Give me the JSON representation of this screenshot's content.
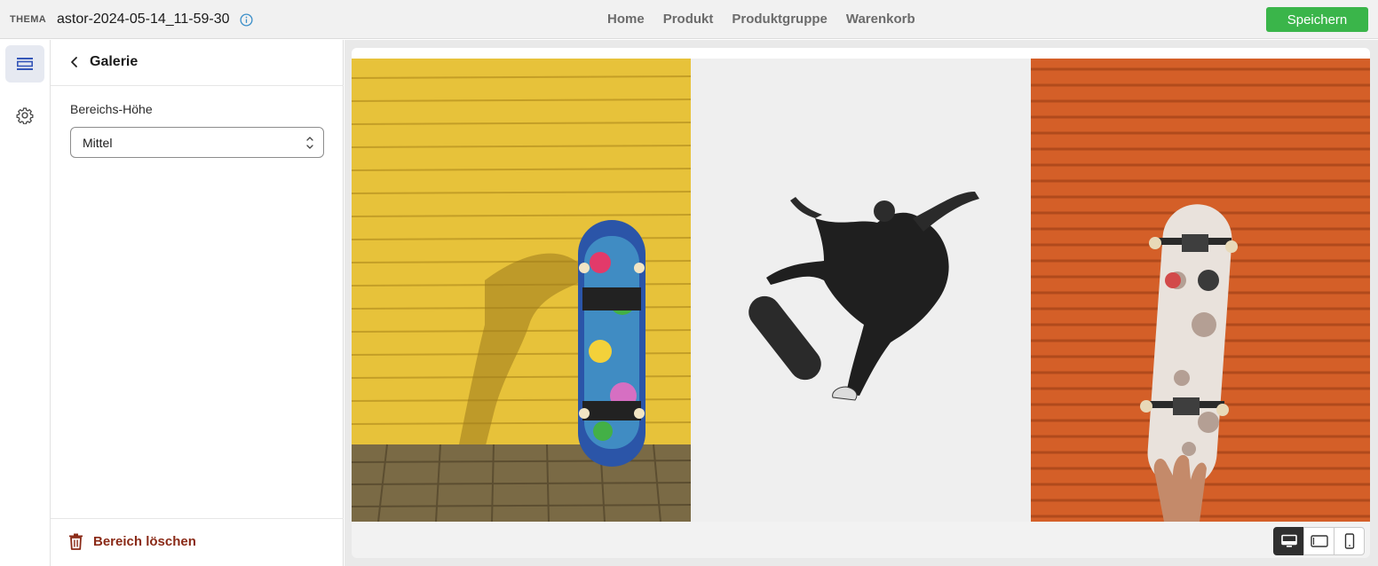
{
  "topbar": {
    "theme_tag": "THEMA",
    "theme_name": "astor-2024-05-14_11-59-30",
    "info_icon": "info-icon",
    "nav": [
      {
        "label": "Home"
      },
      {
        "label": "Produkt"
      },
      {
        "label": "Produktgruppe"
      },
      {
        "label": "Warenkorb"
      }
    ],
    "save_label": "Speichern",
    "save_color": "#3ab54a"
  },
  "rail": {
    "items": [
      {
        "icon": "sections-icon",
        "active": true
      },
      {
        "icon": "gear-icon",
        "active": false
      }
    ]
  },
  "panel": {
    "title": "Galerie",
    "back_icon": "chevron-left-icon",
    "field_label": "Bereichs-Höhe",
    "select_value": "Mittel",
    "delete_label": "Bereich löschen",
    "delete_color": "#8a2a17"
  },
  "preview": {
    "images": [
      {
        "subject": "skateboard-against-yellow-wall"
      },
      {
        "subject": "skateboarder-mid-air-black-and-white"
      },
      {
        "subject": "hand-holding-skateboard-orange-shutter"
      }
    ],
    "device_modes": [
      {
        "icon": "desktop-icon",
        "active": true
      },
      {
        "icon": "tablet-icon",
        "active": false
      },
      {
        "icon": "mobile-icon",
        "active": false
      }
    ]
  }
}
